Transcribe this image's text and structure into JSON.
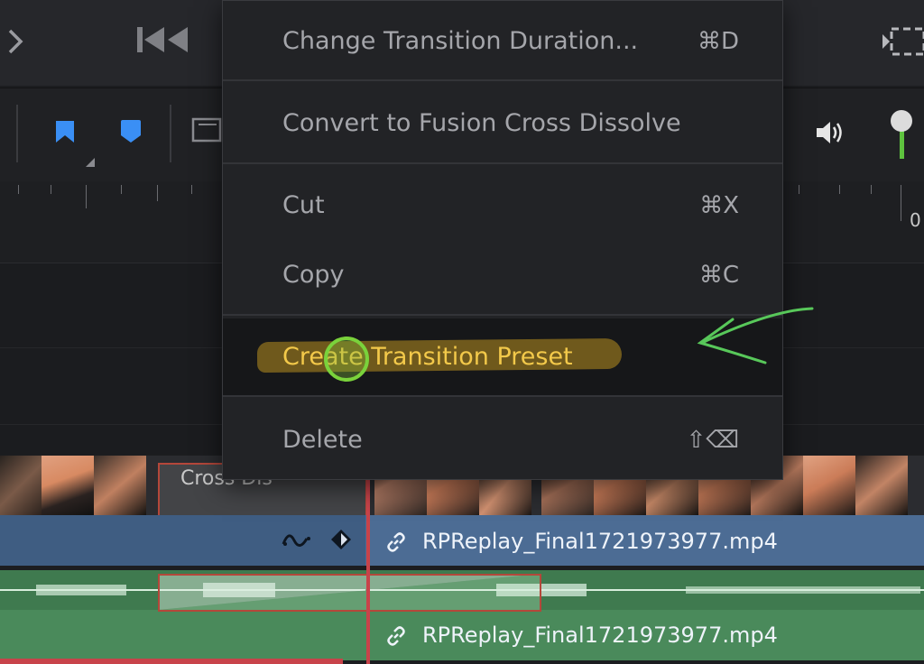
{
  "header": {
    "nav_icon": "chevron-right-icon",
    "skip_icon": "skip-to-start-icon",
    "corner_icon": "clip-view-icon"
  },
  "toolbar": {
    "flag_color": "#3a8ff5",
    "marker_color": "#3a8ff5",
    "audio_icon": "speaker-icon",
    "volume_icon": "volume-knob-icon"
  },
  "ruler": {
    "timecode_partial": "0"
  },
  "context_menu": {
    "items": [
      {
        "label": "Change Transition Duration...",
        "shortcut": "⌘D"
      },
      {
        "label": "Convert to Fusion Cross Dissolve",
        "shortcut": ""
      },
      {
        "label": "Cut",
        "shortcut": "⌘X"
      },
      {
        "label": "Copy",
        "shortcut": "⌘C"
      },
      {
        "label": "Create Transition Preset",
        "shortcut": "",
        "highlighted": true
      },
      {
        "label": "Delete",
        "shortcut": "⇧⌫"
      }
    ],
    "highlight_color": "#f3c94a",
    "cursor_color": "#7ad23b",
    "annotation_arrow_color": "#58c85a"
  },
  "timeline": {
    "transition_label": "Cross Dis",
    "video_clip_name": "RPReplay_Final1721973977.mp4",
    "audio_clip_name": "RPReplay_Final1721973977.mp4",
    "video_track_color": "#4c6c94",
    "audio_track_color": "#4a8a5b",
    "playhead_color": "#c8434a"
  }
}
